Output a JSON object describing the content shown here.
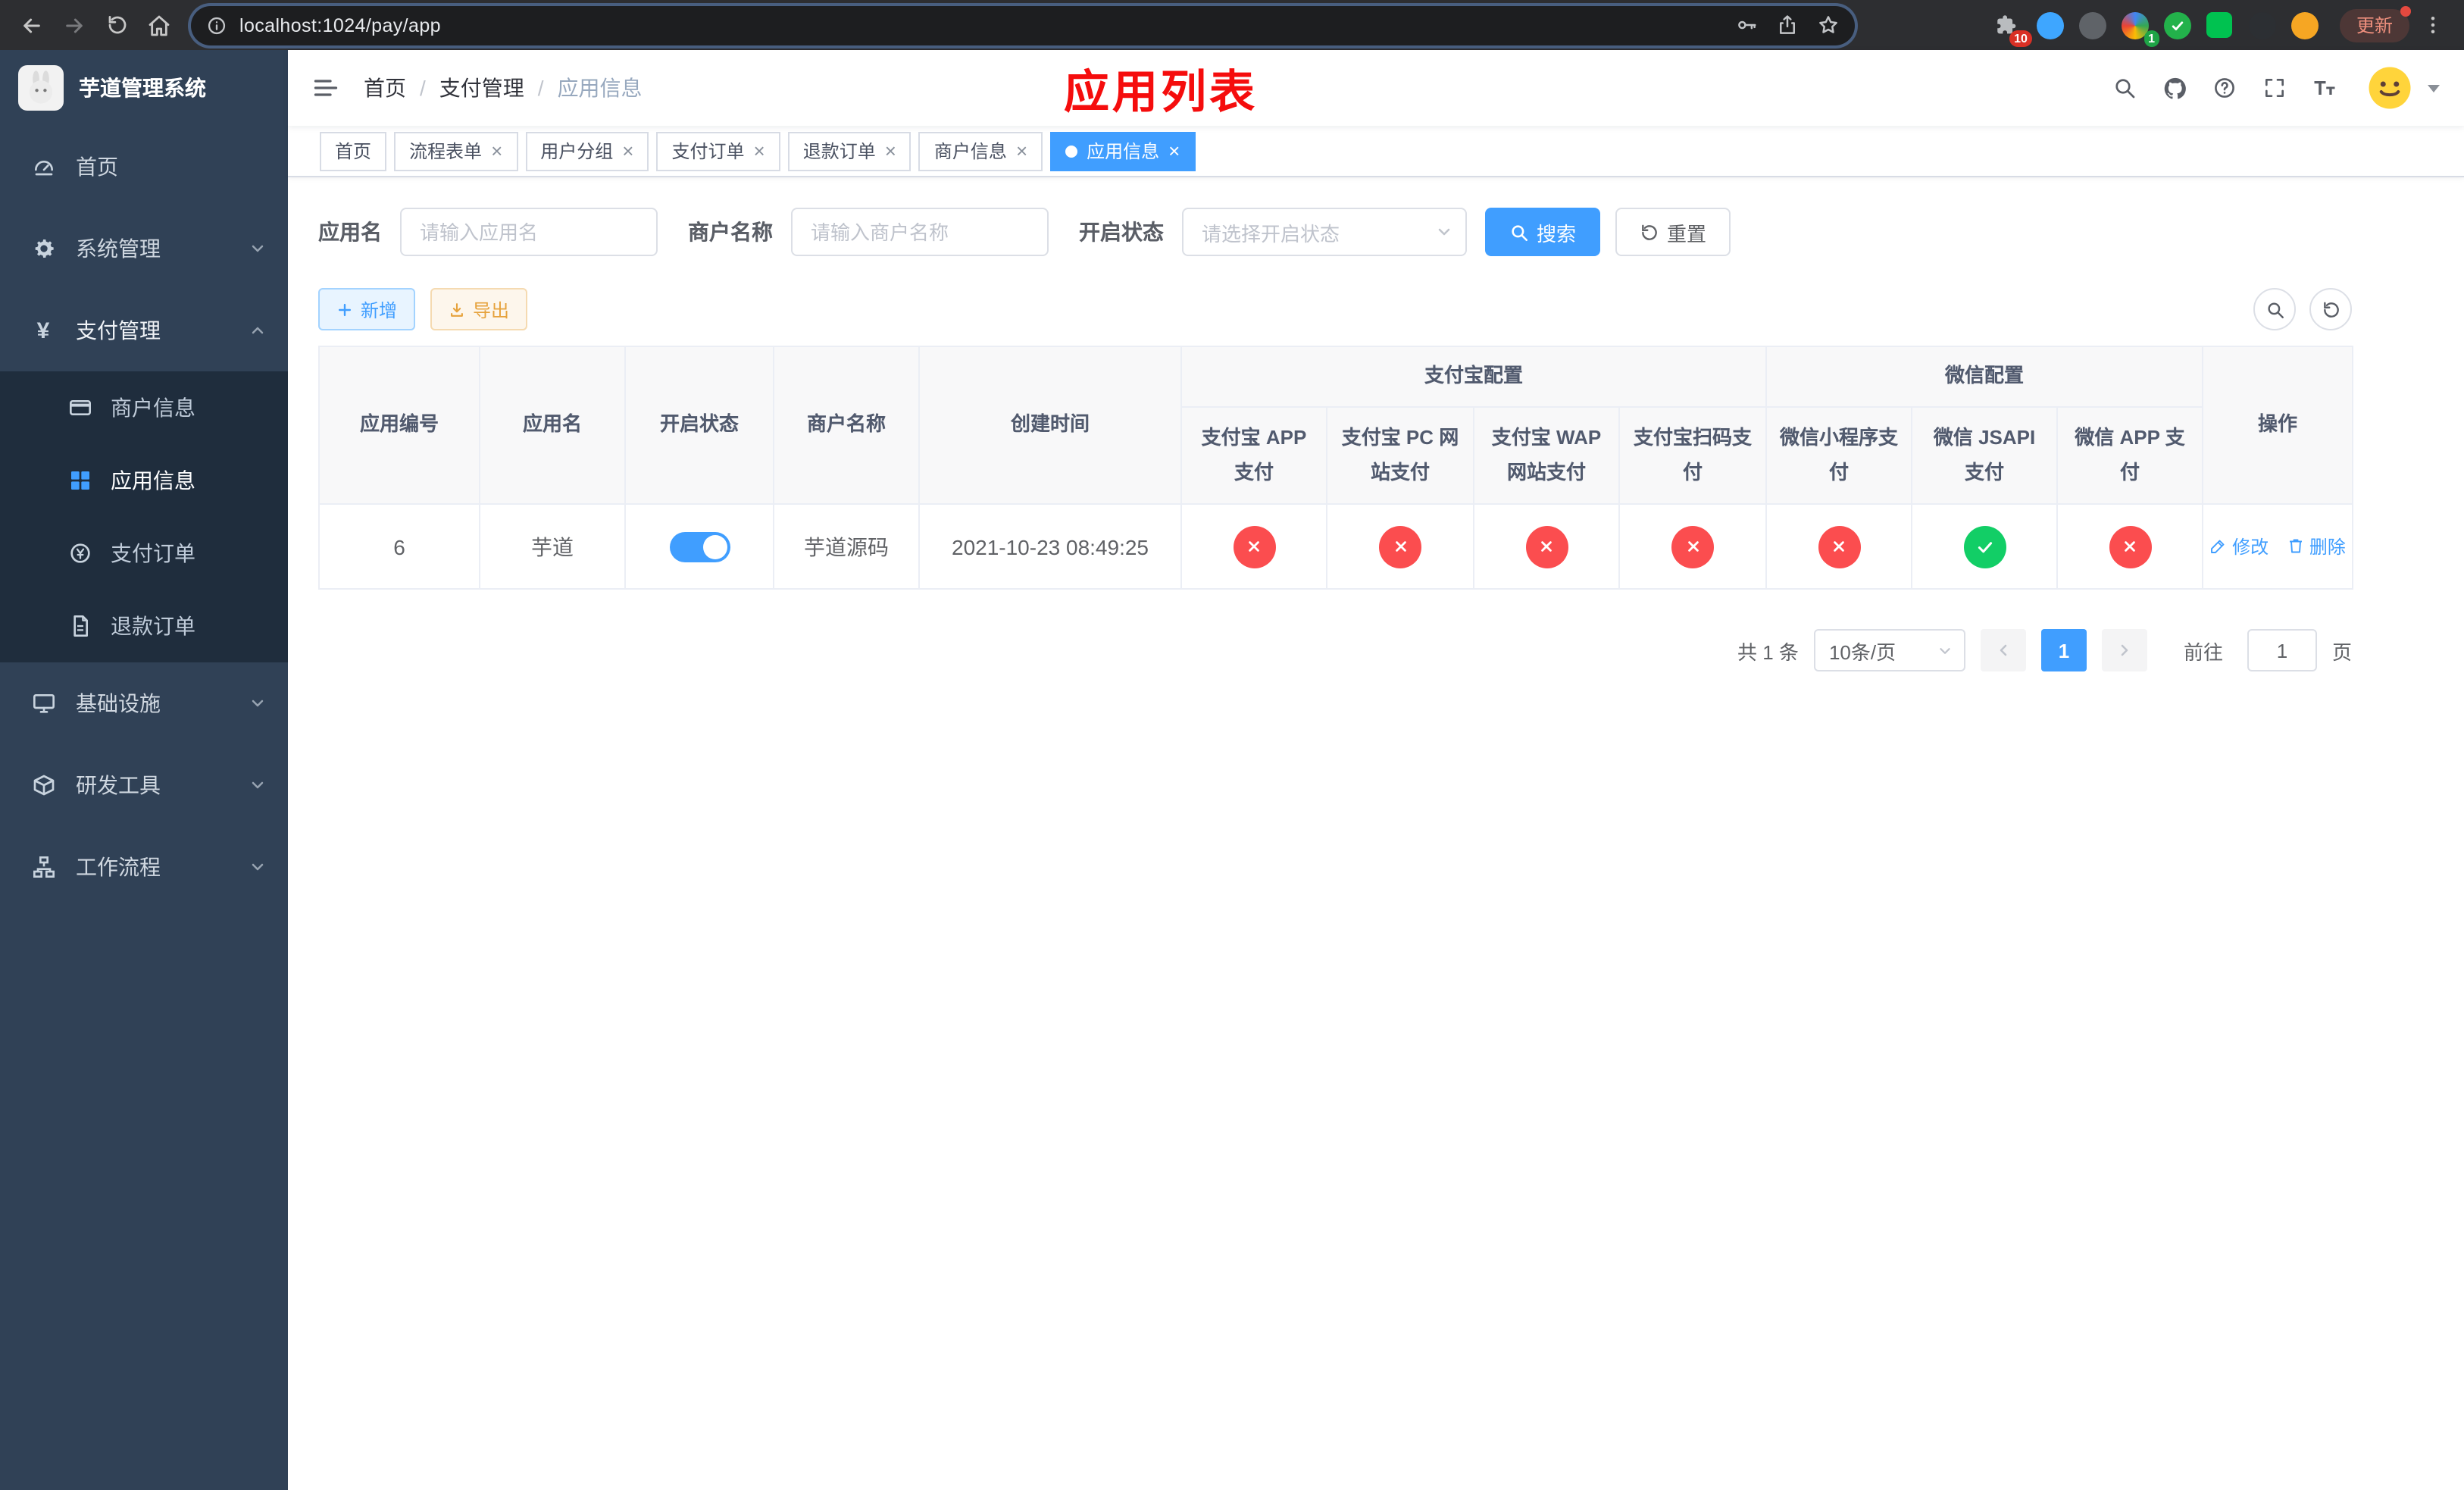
{
  "browser": {
    "url": "localhost:1024/pay/app",
    "update_label": "更新",
    "extensions_badge": "10",
    "profile_badge": "1"
  },
  "header": {
    "overlay_title": "应用列表",
    "breadcrumb": {
      "home": "首页",
      "section": "支付管理",
      "current": "应用信息",
      "separator": "/"
    }
  },
  "sidebar": {
    "brand": "芋道管理系统",
    "items": {
      "home": "首页",
      "system": "系统管理",
      "payment": "支付管理",
      "infra": "基础设施",
      "devtools": "研发工具",
      "workflow": "工作流程"
    },
    "payment_children": {
      "merchant": "商户信息",
      "app": "应用信息",
      "order": "支付订单",
      "refund": "退款订单"
    }
  },
  "tabs": [
    {
      "label": "首页"
    },
    {
      "label": "流程表单"
    },
    {
      "label": "用户分组"
    },
    {
      "label": "支付订单"
    },
    {
      "label": "退款订单"
    },
    {
      "label": "商户信息"
    },
    {
      "label": "应用信息"
    }
  ],
  "filters": {
    "app_name_label": "应用名",
    "app_name_placeholder": "请输入应用名",
    "merchant_label": "商户名称",
    "merchant_placeholder": "请输入商户名称",
    "status_label": "开启状态",
    "status_placeholder": "请选择开启状态",
    "search_label": "搜索",
    "reset_label": "重置"
  },
  "toolbar": {
    "add_label": "新增",
    "export_label": "导出"
  },
  "table": {
    "groups": {
      "alipay": "支付宝配置",
      "wechat": "微信配置"
    },
    "columns": {
      "app_no": "应用编号",
      "app_name": "应用名",
      "status": "开启状态",
      "merchant": "商户名称",
      "created": "创建时间",
      "alipay_app": "支付宝 APP 支付",
      "alipay_pc": "支付宝 PC 网站支付",
      "alipay_wap": "支付宝 WAP 网站支付",
      "alipay_qr": "支付宝扫码支付",
      "wx_mini": "微信小程序支付",
      "wx_jsapi": "微信 JSAPI 支付",
      "wx_app": "微信 APP 支付",
      "actions": "操作"
    },
    "row": {
      "app_no": "6",
      "app_name": "芋道",
      "status_enabled": true,
      "merchant": "芋道源码",
      "created": "2021-10-23 08:49:25",
      "configs": {
        "alipay_app": "disabled",
        "alipay_pc": "disabled",
        "alipay_wap": "disabled",
        "alipay_qr": "disabled",
        "wx_mini": "disabled",
        "wx_jsapi": "enabled",
        "wx_app": "disabled"
      },
      "edit_label": "修改",
      "delete_label": "删除"
    }
  },
  "pagination": {
    "total_text": "共 1 条",
    "page_size": "10条/页",
    "current_page": "1",
    "goto_label": "前往",
    "page_input": "1",
    "page_unit": "页"
  }
}
